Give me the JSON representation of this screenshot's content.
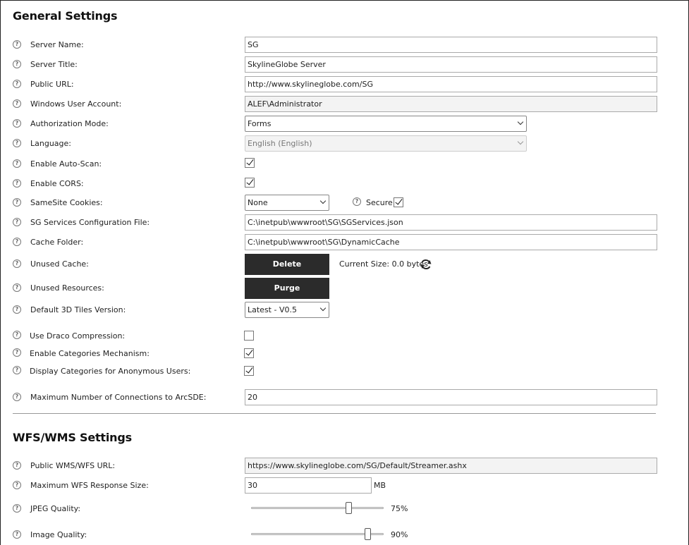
{
  "general": {
    "title": "General Settings",
    "server_name": {
      "label": "Server Name:",
      "value": "SG"
    },
    "server_title": {
      "label": "Server Title:",
      "value": "SkylineGlobe Server"
    },
    "public_url": {
      "label": "Public URL:",
      "value": "http://www.skylineglobe.com/SG"
    },
    "windows_user": {
      "label": "Windows User Account:",
      "value": "ALEF\\Administrator"
    },
    "auth_mode": {
      "label": "Authorization Mode:",
      "value": "Forms"
    },
    "language": {
      "label": "Language:",
      "value": "English (English)"
    },
    "auto_scan": {
      "label": "Enable Auto-Scan:",
      "checked": true
    },
    "cors": {
      "label": "Enable CORS:",
      "checked": true
    },
    "samesite": {
      "label": "SameSite Cookies:",
      "value": "None",
      "secure_label": "Secure",
      "secure_checked": true
    },
    "services_config": {
      "label": "SG Services Configuration File:",
      "value": "C:\\inetpub\\wwwroot\\SG\\SGServices.json"
    },
    "cache_folder": {
      "label": "Cache Folder:",
      "value": "C:\\inetpub\\wwwroot\\SG\\DynamicCache"
    },
    "unused_cache": {
      "label": "Unused Cache:",
      "button": "Delete",
      "current_size": "Current Size: 0.0 bytes"
    },
    "unused_resources": {
      "label": "Unused Resources:",
      "button": "Purge"
    },
    "tiles_version": {
      "label": "Default 3D Tiles Version:",
      "value": "Latest - V0.5"
    },
    "draco": {
      "label": "Use Draco Compression:",
      "checked": false
    },
    "categories": {
      "label": "Enable Categories Mechanism:",
      "checked": true
    },
    "categories_anon": {
      "label": "Display Categories for Anonymous Users:",
      "checked": true
    },
    "max_connections": {
      "label": "Maximum Number of Connections to ArcSDE:",
      "value": "20"
    }
  },
  "wfs": {
    "title": "WFS/WMS Settings",
    "public_url": {
      "label": "Public WMS/WFS URL:",
      "value": "https://www.skylineglobe.com/SG/Default/Streamer.ashx"
    },
    "max_response": {
      "label": "Maximum WFS Response Size:",
      "value": "30",
      "unit": "MB"
    },
    "jpeg_quality": {
      "label": "JPEG Quality:",
      "value": 0.75,
      "display": "75%"
    },
    "image_quality": {
      "label": "Image Quality:",
      "value": 0.9,
      "display": "90%"
    }
  },
  "icons": {
    "help": "?"
  }
}
